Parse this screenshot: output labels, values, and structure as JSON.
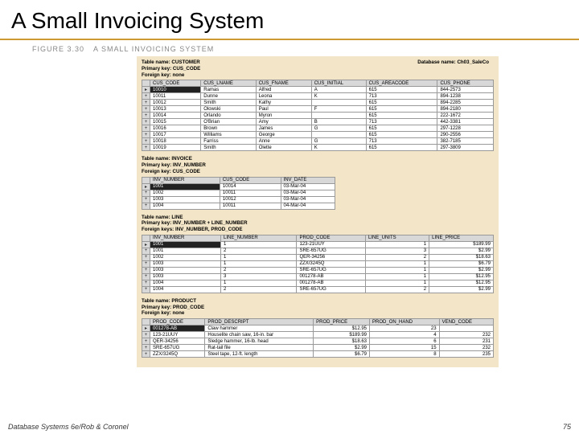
{
  "slide": {
    "title": "A Small Invoicing System",
    "figure_label": "FIGURE 3.30",
    "figure_title": "A Small Invoicing System",
    "database_name_label": "Database name:",
    "database_name": "Ch03_SaleCo"
  },
  "tables": {
    "customer": {
      "name_label": "Table name:",
      "name": "CUSTOMER",
      "pk_label": "Primary key:",
      "pk": "CUS_CODE",
      "fk_label": "Foreign key:",
      "fk": "none",
      "columns": [
        "CUS_CODE",
        "CUS_LNAME",
        "CUS_FNAME",
        "CUS_INITIAL",
        "CUS_AREACODE",
        "CUS_PHONE"
      ],
      "rows": [
        [
          "10010",
          "Ramas",
          "Alfred",
          "A",
          "615",
          "844-2573"
        ],
        [
          "10011",
          "Dunne",
          "Leona",
          "K",
          "713",
          "894-1238"
        ],
        [
          "10012",
          "Smith",
          "Kathy",
          "",
          "615",
          "894-2285"
        ],
        [
          "10013",
          "Olowski",
          "Paul",
          "F",
          "615",
          "894-2180"
        ],
        [
          "10014",
          "Orlando",
          "Myron",
          "",
          "615",
          "222-1672"
        ],
        [
          "10015",
          "O'Brian",
          "Amy",
          "B",
          "713",
          "442-3381"
        ],
        [
          "10016",
          "Brown",
          "James",
          "G",
          "615",
          "297-1228"
        ],
        [
          "10017",
          "Williams",
          "George",
          "",
          "615",
          "290-2556"
        ],
        [
          "10018",
          "Farriss",
          "Anne",
          "G",
          "713",
          "382-7185"
        ],
        [
          "10019",
          "Smith",
          "Olette",
          "K",
          "615",
          "297-3809"
        ]
      ]
    },
    "invoice": {
      "name_label": "Table name:",
      "name": "INVOICE",
      "pk_label": "Primary key:",
      "pk": "INV_NUMBER",
      "fk_label": "Foreign key:",
      "fk": "CUS_CODE",
      "columns": [
        "INV_NUMBER",
        "CUS_CODE",
        "INV_DATE"
      ],
      "rows": [
        [
          "1001",
          "10014",
          "03-Mar-04"
        ],
        [
          "1002",
          "10011",
          "03-Mar-04"
        ],
        [
          "1003",
          "10012",
          "03-Mar-04"
        ],
        [
          "1004",
          "10011",
          "04-Mar-04"
        ]
      ]
    },
    "line": {
      "name_label": "Table name:",
      "name": "LINE",
      "pk_label": "Primary key:",
      "pk": "INV_NUMBER + LINE_NUMBER",
      "fk_label": "Foreign keys:",
      "fk": "INV_NUMBER, PROD_CODE",
      "columns": [
        "INV_NUMBER",
        "LINE_NUMBER",
        "PROD_CODE",
        "LINE_UNITS",
        "LINE_PRICE"
      ],
      "rows": [
        [
          "1001",
          "1",
          "123-21UUY",
          "1",
          "$189.99"
        ],
        [
          "1001",
          "2",
          "SRE-657UG",
          "3",
          "$2.99"
        ],
        [
          "1002",
          "1",
          "QER-34256",
          "2",
          "$18.63"
        ],
        [
          "1003",
          "1",
          "ZZX/3245Q",
          "1",
          "$6.79"
        ],
        [
          "1003",
          "2",
          "SRE-657UG",
          "1",
          "$2.99"
        ],
        [
          "1003",
          "3",
          "001278-AB",
          "1",
          "$12.95"
        ],
        [
          "1004",
          "1",
          "001278-AB",
          "1",
          "$12.95"
        ],
        [
          "1004",
          "2",
          "SRE-657UG",
          "2",
          "$2.99"
        ]
      ]
    },
    "product": {
      "name_label": "Table name:",
      "name": "PRODUCT",
      "pk_label": "Primary key:",
      "pk": "PROD_CODE",
      "fk_label": "Foreign key:",
      "fk": "none",
      "columns": [
        "PROD_CODE",
        "PROD_DESCRIPT",
        "PROD_PRICE",
        "PROD_ON_HAND",
        "VEND_CODE"
      ],
      "rows": [
        [
          "001278-AB",
          "Claw hammer",
          "$12.95",
          "23",
          ""
        ],
        [
          "123-21UUY",
          "Houselite chain saw, 16-in. bar",
          "$189.99",
          "4",
          "232"
        ],
        [
          "QER-34256",
          "Sledge hammer, 16-lb. head",
          "$18.63",
          "6",
          "231"
        ],
        [
          "SRE-657UG",
          "Rat-tail file",
          "$2.99",
          "15",
          "232"
        ],
        [
          "ZZX/3245Q",
          "Steel tape, 12-ft. length",
          "$6.79",
          "8",
          "235"
        ]
      ]
    }
  },
  "footer": {
    "text": "Database Systems 6e/Rob & Coronel",
    "page": "75"
  }
}
